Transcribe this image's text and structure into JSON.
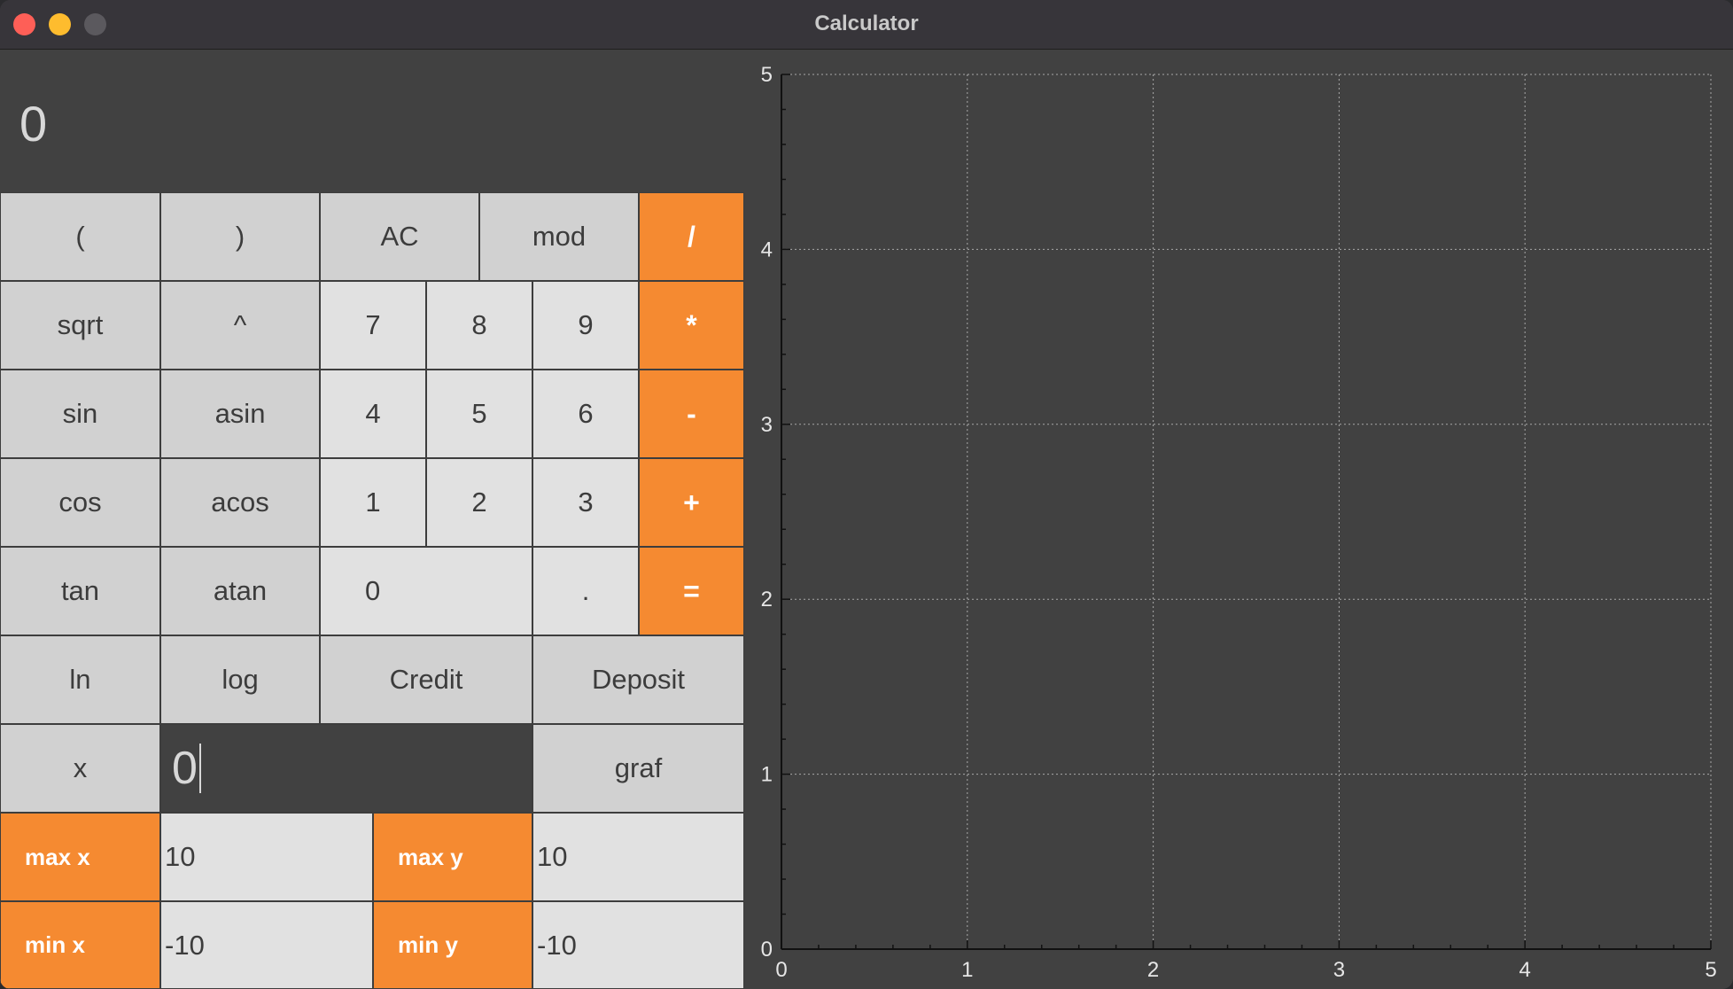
{
  "window": {
    "title": "Calculator"
  },
  "display": {
    "value": "0"
  },
  "keys": {
    "lparen": "(",
    "rparen": ")",
    "ac": "AC",
    "mod": "mod",
    "div": "/",
    "sqrt": "sqrt",
    "pow": "^",
    "k7": "7",
    "k8": "8",
    "k9": "9",
    "mul": "*",
    "sin": "sin",
    "asin": "asin",
    "k4": "4",
    "k5": "5",
    "k6": "6",
    "minus": "-",
    "cos": "cos",
    "acos": "acos",
    "k1": "1",
    "k2": "2",
    "k3": "3",
    "plus": "+",
    "tan": "tan",
    "atan": "atan",
    "k0": "0",
    "dot": ".",
    "eq": "=",
    "ln": "ln",
    "log": "log",
    "credit": "Credit",
    "deposit": "Deposit",
    "x": "x",
    "graf": "graf"
  },
  "x_input": {
    "value": "0"
  },
  "range": {
    "max_x_label": "max x",
    "max_x_value": "10",
    "max_y_label": "max y",
    "max_y_value": "10",
    "min_x_label": "min x",
    "min_x_value": "-10",
    "min_y_label": "min y",
    "min_y_value": "-10"
  },
  "chart_data": {
    "type": "line",
    "series": [],
    "xlim": [
      0,
      5
    ],
    "ylim": [
      0,
      5
    ],
    "x_ticks": [
      "0",
      "1",
      "2",
      "3",
      "4",
      "5"
    ],
    "y_ticks": [
      "0",
      "1",
      "2",
      "3",
      "4",
      "5"
    ],
    "grid": true,
    "title": "",
    "xlabel": "",
    "ylabel": ""
  },
  "colors": {
    "accent": "#f58a31",
    "function_key": "#d1d1d1",
    "digit_key": "#e1e1e1",
    "panel_bg": "#414141"
  }
}
